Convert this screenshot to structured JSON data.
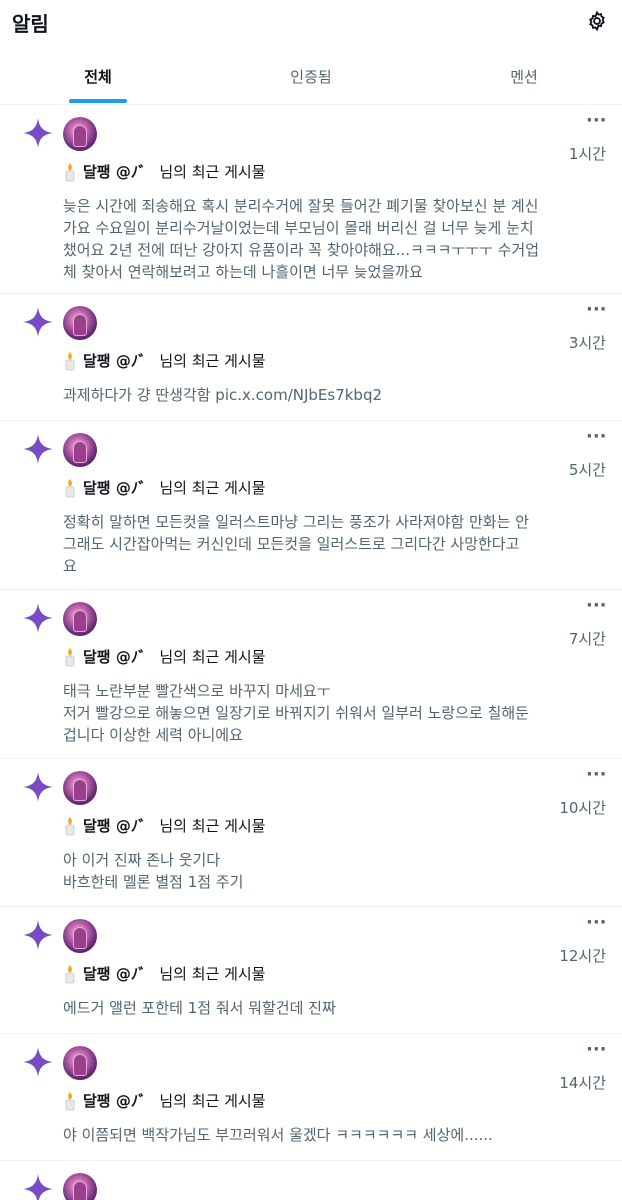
{
  "header": {
    "title": "알림",
    "settings_icon": "gear-icon"
  },
  "tabs": [
    {
      "label": "전체",
      "active": true
    },
    {
      "label": "인증됨",
      "active": false
    },
    {
      "label": "멘션",
      "active": false
    }
  ],
  "notifications": [
    {
      "time": "1시간",
      "user": "달팽 @ﾉ゛",
      "suffix": "님의 최근 게시물",
      "text": "늦은 시간에 죄송해요 혹시 분리수거에 잘못 들어간 폐기물 찾아보신 분 계신\n가요 수요일이 분리수거날이었는데 부모님이 몰래 버리신 걸 너무 늦게 눈치\n챘어요 2년 전에 떠난 강아지 유품이라 꼭 찾아야해요...ㅋㅋㅋㅜㅜㅜ 수거업\n체 찾아서 연락해보려고 하는데 나흘이면 너무 늦었을까요"
    },
    {
      "time": "3시간",
      "user": "달팽 @ﾉ゛",
      "suffix": "님의 최근 게시물",
      "text": "과제하다가 걍 딴생각함 pic.x.com/NJbEs7kbq2"
    },
    {
      "time": "5시간",
      "user": "달팽 @ﾉ゛",
      "suffix": "님의 최근 게시물",
      "text": "정확히 말하면 모든컷을 일러스트마냥 그리는 풍조가 사라져야함 만화는 안\n그래도 시간잡아먹는 커신인데 모든컷을 일러스트로 그리다간 사망한다고\n요"
    },
    {
      "time": "7시간",
      "user": "달팽 @ﾉ゛",
      "suffix": "님의 최근 게시물",
      "text": "태극 노란부분 빨간색으로 바꾸지 마세요ㅜ\n저거 빨강으로 해놓으면 일장기로 바꿔지기 쉬워서 일부러 노랑으로 칠해둔\n겁니다 이상한 세력 아니에요"
    },
    {
      "time": "10시간",
      "user": "달팽 @ﾉ゛",
      "suffix": "님의 최근 게시물",
      "text": "아 이거 진짜 존나 웃기다\n바흐한테 멜론 별점 1점 주기"
    },
    {
      "time": "12시간",
      "user": "달팽 @ﾉ゛",
      "suffix": "님의 최근 게시물",
      "text": "에드거 앨런 포한테 1점 줘서 뭐할건데 진짜"
    },
    {
      "time": "14시간",
      "user": "달팽 @ﾉ゛",
      "suffix": "님의 최근 게시물",
      "text": "야 이쯤되면 백작가님도 부끄러워서 울겠다 ㅋㅋㅋㅋㅋㅋ 세상에......"
    },
    {
      "time": "",
      "user": "",
      "suffix": "",
      "text": ""
    }
  ],
  "colors": {
    "accent": "#1d9bf0",
    "sparkle": "#794bc4",
    "muted": "#536471"
  }
}
